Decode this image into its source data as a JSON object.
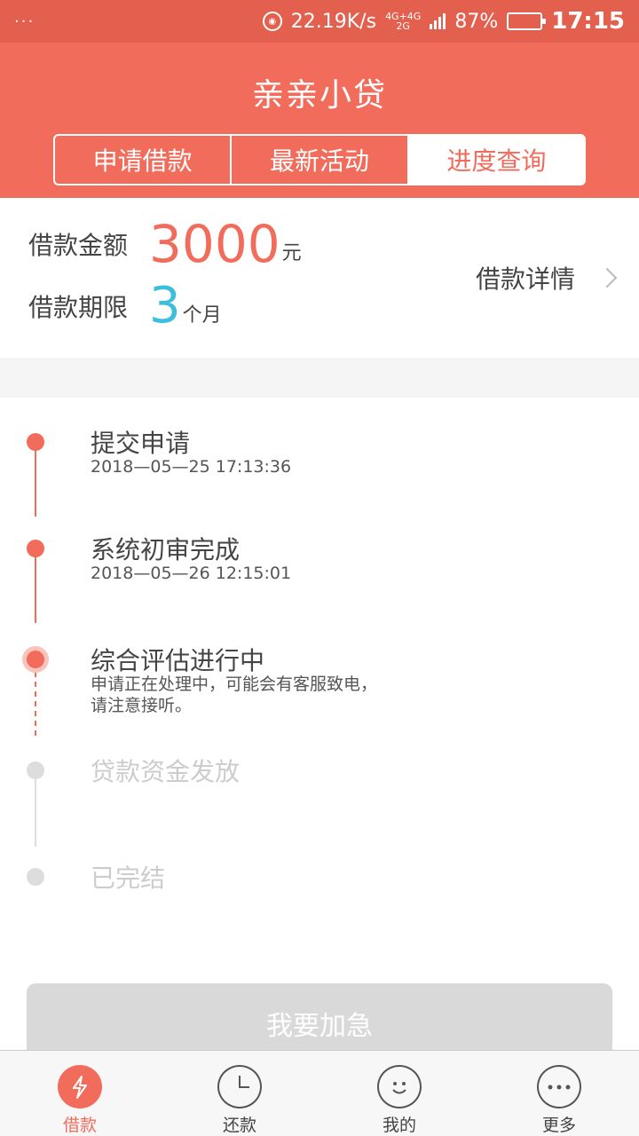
{
  "status": {
    "speed": "22.19K/s",
    "network_top": "4G+4G",
    "network_bottom": "2G",
    "battery": "87%",
    "battery_level": 0.87,
    "time": "17:15"
  },
  "header": {
    "title": "亲亲小贷",
    "tabs": [
      {
        "label": "申请借款",
        "active": false
      },
      {
        "label": "最新活动",
        "active": false
      },
      {
        "label": "进度查询",
        "active": true
      }
    ]
  },
  "summary": {
    "amount_label": "借款金额",
    "amount": "3000",
    "amount_unit": "元",
    "term_label": "借款期限",
    "term": "3",
    "term_unit": "个月",
    "detail_link": "借款详情"
  },
  "timeline": {
    "steps": [
      {
        "title": "提交申请",
        "sub": "2018—05—25 17:13:36",
        "state": "done"
      },
      {
        "title": "系统初审完成",
        "sub": "2018—05—26 12:15:01",
        "state": "done"
      },
      {
        "title": "综合评估进行中",
        "sub": "申请正在处理中，可能会有客服致电，请注意接听。",
        "state": "current"
      },
      {
        "title": "贷款资金发放",
        "sub": "",
        "state": "pending"
      },
      {
        "title": "已完结",
        "sub": "",
        "state": "pending"
      }
    ],
    "urge_button": "我要加急"
  },
  "bottom_nav": {
    "items": [
      {
        "label": "借款",
        "icon": "lightning-icon",
        "active": true
      },
      {
        "label": "还款",
        "icon": "clock-icon",
        "active": false
      },
      {
        "label": "我的",
        "icon": "smiley-icon",
        "active": false
      },
      {
        "label": "更多",
        "icon": "more-dots-icon",
        "active": false
      }
    ]
  },
  "colors": {
    "brand": "#f26c5c",
    "term_accent": "#3bbfdd"
  }
}
